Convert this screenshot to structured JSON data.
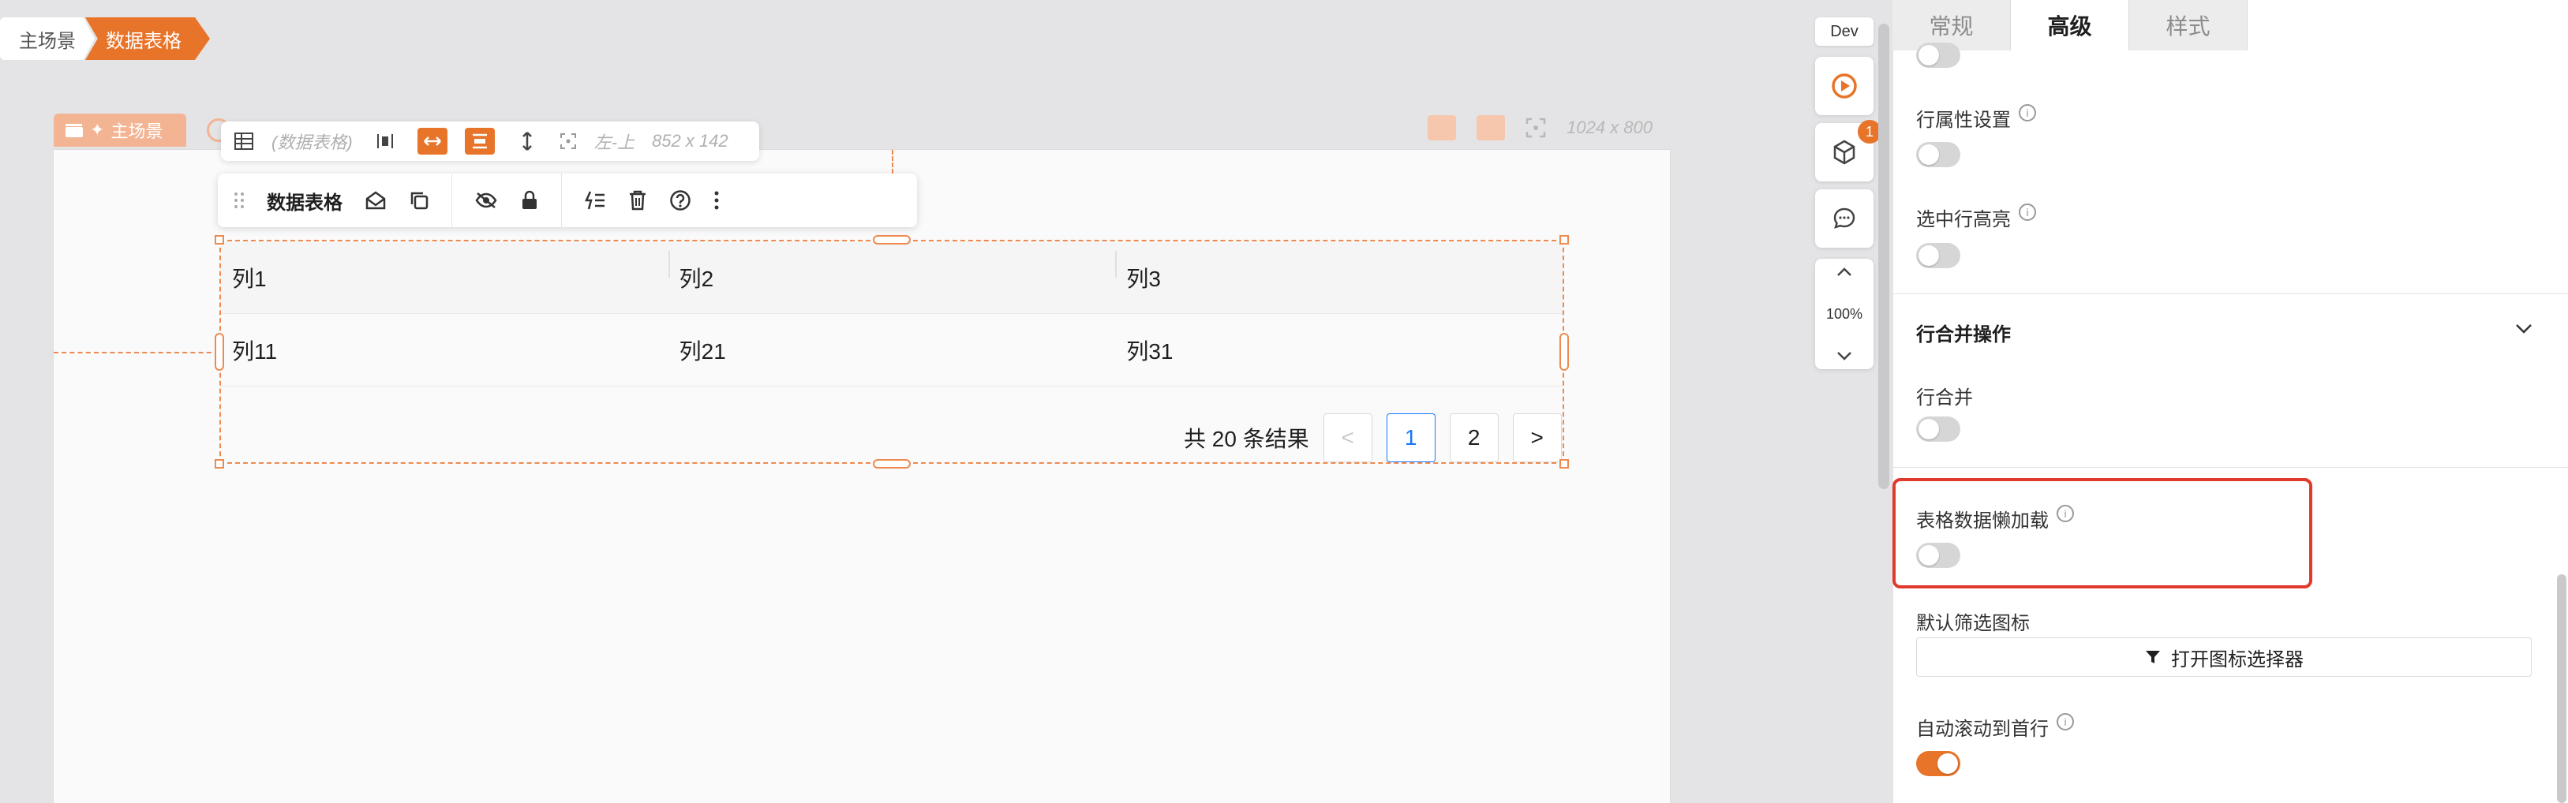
{
  "breadcrumb": {
    "root": "主场景",
    "current": "数据表格"
  },
  "canvas": {
    "scene_tag": "主场景",
    "size_label": "1024 x 800"
  },
  "sub_toolbar": {
    "component_name": "(数据表格)",
    "position": "左-上",
    "size": "852 x 142"
  },
  "main_toolbar": {
    "title": "数据表格"
  },
  "table": {
    "columns": [
      "列1",
      "列2",
      "列3"
    ],
    "rows": [
      [
        "列11",
        "列21",
        "列31"
      ]
    ]
  },
  "pagination": {
    "total_text": "共 20 条结果",
    "prev": "<",
    "pages": [
      "1",
      "2"
    ],
    "current": "1",
    "next": ">"
  },
  "side_tools": {
    "env_tag": "Dev",
    "badge_count": "1",
    "zoom": "100%"
  },
  "panel": {
    "tabs": [
      {
        "label": "常规",
        "active": false
      },
      {
        "label": "高级",
        "active": true
      },
      {
        "label": "样式",
        "active": false
      }
    ],
    "items": {
      "row_props": "行属性设置",
      "highlight_row": "选中行高亮",
      "merge_section": "行合并操作",
      "row_merge": "行合并",
      "lazy_load": "表格数据懒加载",
      "filter_icon": "默认筛选图标",
      "open_icon_picker": "打开图标选择器",
      "auto_scroll": "自动滚动到首行"
    },
    "toggles": {
      "row_props": false,
      "highlight_row": false,
      "row_merge": false,
      "lazy_load": false,
      "auto_scroll": true
    }
  },
  "colors": {
    "accent": "#e8742a",
    "highlight_border": "#e03a2c",
    "link": "#1677ff"
  }
}
